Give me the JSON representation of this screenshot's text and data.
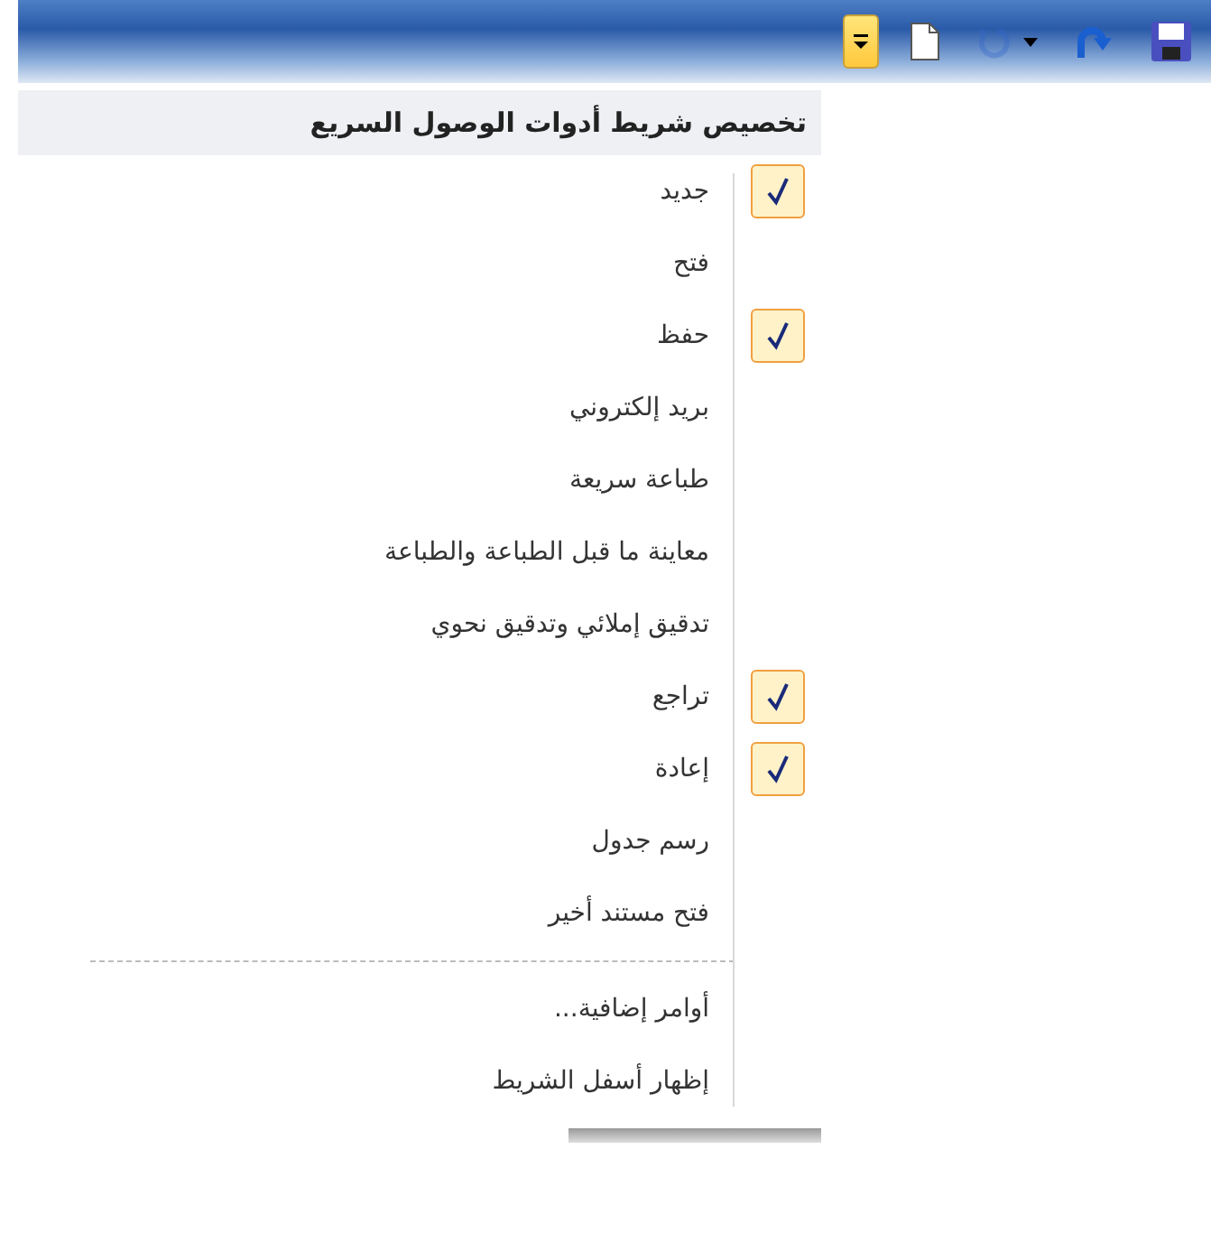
{
  "toolbar": {
    "buttons": [
      {
        "kind": "customize",
        "expanded": true,
        "disabled": false
      },
      {
        "kind": "new",
        "disabled": false
      },
      {
        "kind": "undo",
        "disabled": true
      },
      {
        "kind": "redo",
        "disabled": false
      },
      {
        "kind": "save",
        "disabled": false
      }
    ]
  },
  "menu": {
    "title": "تخصيص شريط أدوات الوصول السريع",
    "items": [
      {
        "label": "جديد",
        "checked": true
      },
      {
        "label": "فتح",
        "checked": false
      },
      {
        "label": "حفظ",
        "checked": true
      },
      {
        "label": "بريد إلكتروني",
        "checked": false
      },
      {
        "label": "طباعة سريعة",
        "checked": false
      },
      {
        "label": "معاينة ما قبل الطباعة والطباعة",
        "checked": false
      },
      {
        "label": "تدقيق إملائي وتدقيق نحوي",
        "checked": false
      },
      {
        "label": "تراجع",
        "checked": true
      },
      {
        "label": "إعادة",
        "checked": true
      },
      {
        "label": "رسم جدول",
        "checked": false
      },
      {
        "label": "فتح مستند أخير",
        "checked": false
      }
    ],
    "more_items": [
      {
        "label": "أوامر إضافية..."
      },
      {
        "label": "إظهار أسفل الشريط"
      }
    ]
  }
}
